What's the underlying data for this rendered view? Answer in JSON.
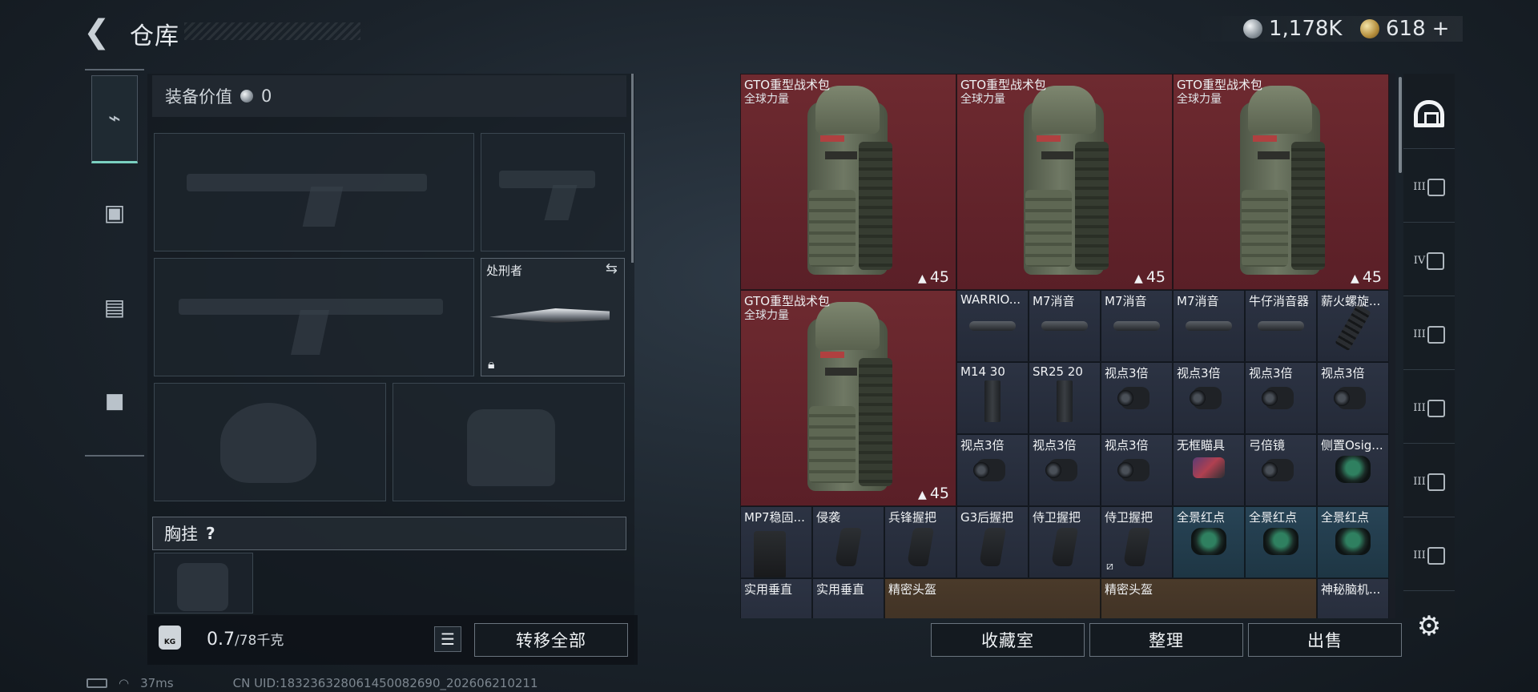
{
  "header": {
    "back_icon": "chevron-left-icon",
    "title": "仓库",
    "currency_silver": "1,178K",
    "currency_gold": "618",
    "gold_plus": "+"
  },
  "left_tabs": [
    {
      "icon": "pistol-icon",
      "active": true
    },
    {
      "icon": "backpack-icon",
      "active": false
    },
    {
      "icon": "vest-icon",
      "active": false
    },
    {
      "icon": "toolbox-icon",
      "active": false
    }
  ],
  "equipment": {
    "value_label": "装备价值",
    "value": "0",
    "knife_name": "处刑者",
    "chest_label": "胸挂",
    "chest_help": "?",
    "weight_current": "0.7",
    "weight_max": "/78千克",
    "weight_icon_text": "KG",
    "transfer_all": "转移全部"
  },
  "storage": {
    "backpack_name": "GTO重型战术包",
    "backpack_brand": "全球力量",
    "backpack_count": "45",
    "items": [
      {
        "name": "WARRIO...",
        "art": "supp"
      },
      {
        "name": "M7消音",
        "art": "supp"
      },
      {
        "name": "M7消音",
        "art": "supp"
      },
      {
        "name": "M7消音",
        "art": "supp"
      },
      {
        "name": "牛仔消音器",
        "art": "supp"
      },
      {
        "name": "薪火螺旋...",
        "art": "rail"
      },
      {
        "name": "M14 30",
        "art": "mag"
      },
      {
        "name": "SR25 20",
        "art": "mag"
      },
      {
        "name": "视点3倍",
        "art": "scope"
      },
      {
        "name": "视点3倍",
        "art": "scope"
      },
      {
        "name": "视点3倍",
        "art": "scope"
      },
      {
        "name": "视点3倍",
        "art": "scope"
      },
      {
        "name": "视点3倍",
        "art": "scope"
      },
      {
        "name": "视点3倍",
        "art": "scope"
      },
      {
        "name": "视点3倍",
        "art": "scope"
      },
      {
        "name": "无框瞄具",
        "art": "redsight"
      },
      {
        "name": "弓倍镜",
        "art": "scope"
      },
      {
        "name": "侧置Osig...",
        "art": "holo"
      }
    ],
    "row5": [
      {
        "name": "MP7稳固...",
        "art": "weap",
        "tone": "dark"
      },
      {
        "name": "侵袭",
        "art": "grip",
        "tone": "dark"
      },
      {
        "name": "兵锋握把",
        "art": "grip",
        "tone": "dark"
      },
      {
        "name": "G3后握把",
        "art": "grip",
        "tone": "dark"
      },
      {
        "name": "侍卫握把",
        "art": "grip",
        "tone": "dark"
      },
      {
        "name": "侍卫握把",
        "art": "grip",
        "tone": "dark"
      },
      {
        "name": "全景红点",
        "art": "holo",
        "tone": "blue"
      },
      {
        "name": "全景红点",
        "art": "holo",
        "tone": "blue"
      },
      {
        "name": "全景红点",
        "art": "holo",
        "tone": "blue"
      }
    ],
    "row6": [
      {
        "name": "实用垂直"
      },
      {
        "name": "实用垂直"
      },
      {
        "name": "精密头盔"
      },
      {
        "name": "精密头盔"
      },
      {
        "name": "神秘脑机..."
      }
    ]
  },
  "buttons": {
    "collection": "收藏室",
    "organize": "整理",
    "sell": "出售"
  },
  "right_tabs": [
    {
      "label": "",
      "icon": "home-icon",
      "active": true
    },
    {
      "label": "III",
      "icon": "container-iii-icon"
    },
    {
      "label": "IV",
      "icon": "container-iv-icon"
    },
    {
      "label": "III",
      "icon": "container-iii-icon"
    },
    {
      "label": "III",
      "icon": "container-iii-icon"
    },
    {
      "label": "III",
      "icon": "container-iii-icon"
    },
    {
      "label": "III",
      "icon": "container-iii-icon"
    }
  ],
  "status": {
    "ping": "37ms",
    "uid": "CN UID:1832363280614500826​90_202606210211"
  },
  "colors": {
    "backpack_cell": "#6e2a30",
    "item_cell": "#2c3343",
    "sight_cell": "#284456",
    "accent_tab": "#7ad0c0"
  }
}
